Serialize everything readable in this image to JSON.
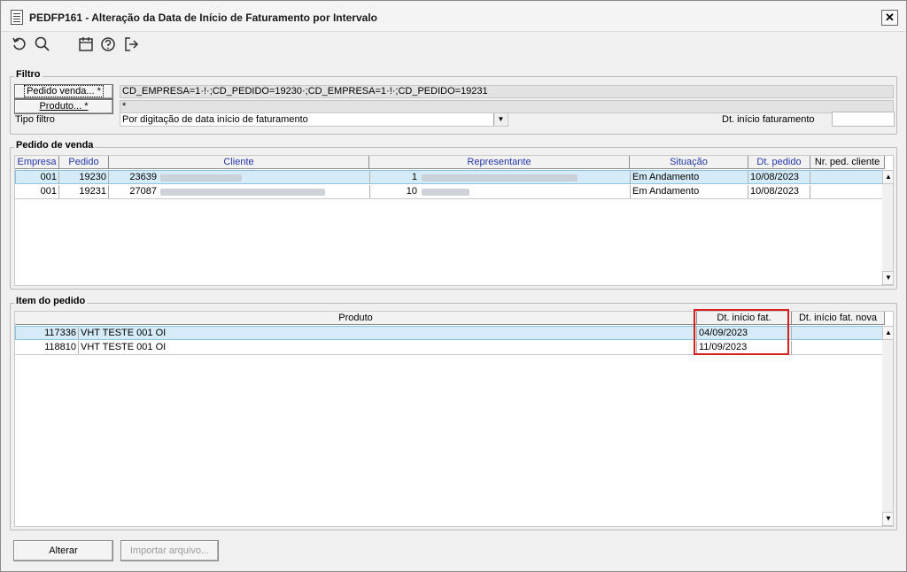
{
  "window": {
    "title": "PEDFP161 - Alteração da Data de Início de Faturamento por Intervalo",
    "close_glyph": "✕"
  },
  "toolbar": {
    "icons": [
      "refresh-icon",
      "search-icon",
      "calendar-icon",
      "help-icon",
      "exit-icon"
    ]
  },
  "filtro": {
    "title": "Filtro",
    "pedido_button": "Pedido venda... *",
    "pedido_value": "CD_EMPRESA=1·!·;CD_PEDIDO=19230·;CD_EMPRESA=1·!·;CD_PEDIDO=19231",
    "produto_button": "Produto... *",
    "produto_value": "*",
    "tipo_label": "Tipo filtro",
    "tipo_value": "Por digitação de data início de faturamento",
    "dt_label": "Dt. início faturamento",
    "dt_value": ""
  },
  "pedido_venda": {
    "title": "Pedido de venda",
    "headers": [
      "Empresa",
      "Pedido",
      "Cliente",
      "Representante",
      "Situação",
      "Dt. pedido",
      "Nr. ped. cliente"
    ],
    "rows": [
      {
        "empresa": "001",
        "pedido": "19230",
        "cliente_cod": "23639",
        "rep_cod": "1",
        "situacao": "Em Andamento",
        "dt_pedido": "10/08/2023",
        "nr_ped_cliente": ""
      },
      {
        "empresa": "001",
        "pedido": "19231",
        "cliente_cod": "27087",
        "rep_cod": "10",
        "situacao": "Em Andamento",
        "dt_pedido": "10/08/2023",
        "nr_ped_cliente": ""
      }
    ]
  },
  "item_pedido": {
    "title": "Item do pedido",
    "headers": [
      "Produto",
      "Dt. início fat.",
      "Dt. início fat. nova"
    ],
    "rows": [
      {
        "codigo": "117336",
        "produto": "VHT TESTE 001 OI",
        "dt_inicio": "04/09/2023",
        "dt_nova": ""
      },
      {
        "codigo": "118810",
        "produto": "VHT TESTE 001 OI",
        "dt_inicio": "11/09/2023",
        "dt_nova": ""
      }
    ]
  },
  "buttons": {
    "alterar": "Alterar",
    "importar": "Importar arquivo..."
  },
  "colors": {
    "selected_row": "#d5ecf8",
    "header_link": "#2236a8",
    "highlight": "#d62020"
  }
}
